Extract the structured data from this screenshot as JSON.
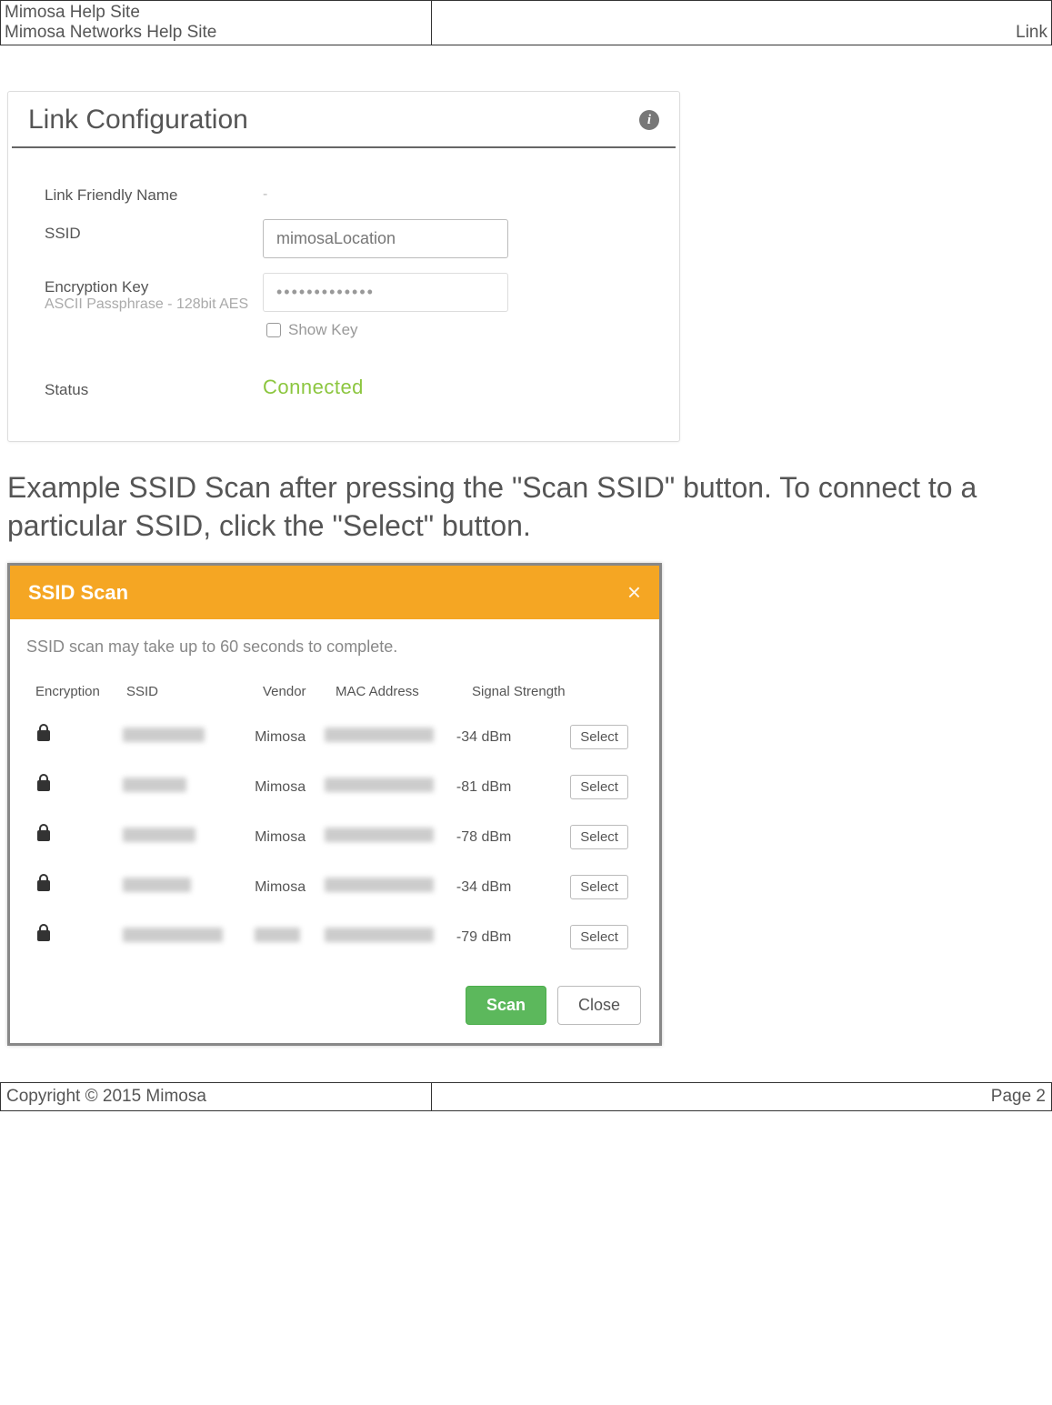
{
  "header": {
    "title_line1": "Mimosa Help Site",
    "title_line2": "Mimosa Networks Help Site",
    "right_label": "Link"
  },
  "panel": {
    "title": "Link Configuration",
    "fields": {
      "link_friendly_name": {
        "label": "Link Friendly Name",
        "value": "-"
      },
      "ssid": {
        "label": "SSID",
        "value": "mimosaLocation"
      },
      "encryption_key": {
        "label": "Encryption Key",
        "sublabel": "ASCII Passphrase - 128bit AES",
        "value": "•••••••••••••",
        "show_key_label": "Show Key"
      },
      "status": {
        "label": "Status",
        "value": "Connected"
      }
    }
  },
  "caption": "Example SSID Scan after pressing the \"Scan SSID\" button. To connect to a particular SSID, click the \"Select\" button.",
  "modal": {
    "title": "SSID Scan",
    "note": "SSID scan may take up to 60 seconds to complete.",
    "columns": {
      "encryption": "Encryption",
      "ssid": "SSID",
      "vendor": "Vendor",
      "mac": "MAC Address",
      "signal": "Signal Strength"
    },
    "rows": [
      {
        "vendor": "Mimosa",
        "signal": "-34 dBm",
        "select": "Select"
      },
      {
        "vendor": "Mimosa",
        "signal": "-81 dBm",
        "select": "Select"
      },
      {
        "vendor": "Mimosa",
        "signal": "-78 dBm",
        "select": "Select"
      },
      {
        "vendor": "Mimosa",
        "signal": "-34 dBm",
        "select": "Select"
      },
      {
        "vendor": "",
        "signal": "-79 dBm",
        "select": "Select"
      }
    ],
    "scan_btn": "Scan",
    "close_btn": "Close"
  },
  "footer": {
    "copyright": "Copyright © 2015 Mimosa",
    "page": "Page 2"
  }
}
